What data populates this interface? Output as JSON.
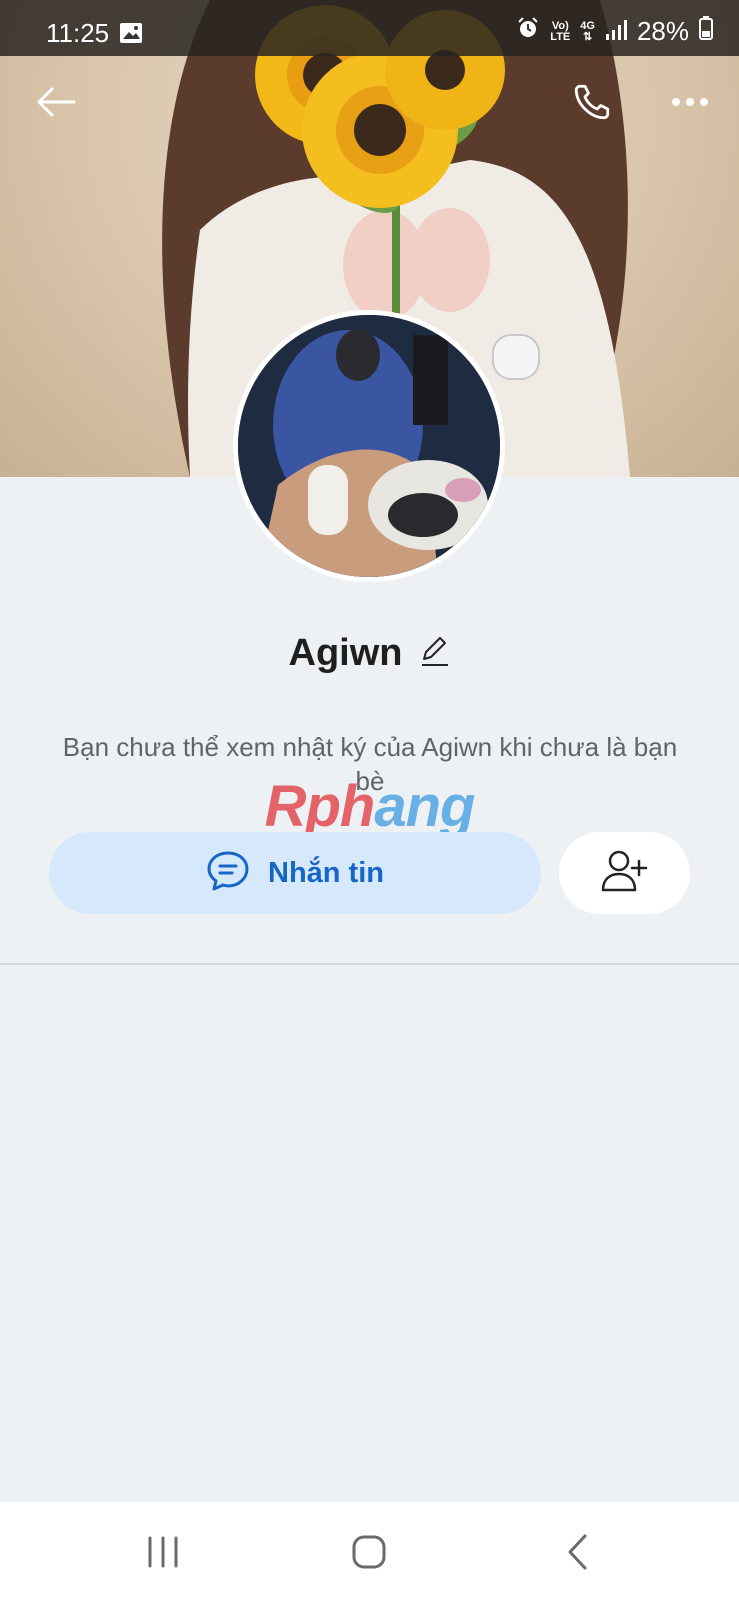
{
  "status_bar": {
    "time": "11:25",
    "network_top": "Vo)",
    "network_bottom": "LTE",
    "data_type": "4G",
    "battery": "28%",
    "icons": [
      "gallery-icon",
      "alarm-icon",
      "signal-icon",
      "battery-icon"
    ]
  },
  "header": {
    "icons": [
      "back-arrow-icon",
      "phone-icon",
      "more-icon"
    ]
  },
  "profile": {
    "name": "Agiwn",
    "notice": "Bạn chưa thể xem nhật ký của Agiwn khi chưa là bạn bè"
  },
  "watermark": {
    "part1": "Rph",
    "part2": "ang"
  },
  "actions": {
    "message_label": "Nhắn tin",
    "message_icon": "chat-icon",
    "add_friend_icon": "add-friend-icon"
  },
  "nav": {
    "icons": [
      "recent-apps-icon",
      "home-icon",
      "back-icon"
    ]
  },
  "colors": {
    "background": "#eef1f3",
    "accent": "#1766c7",
    "message_button": "#d6e8fb"
  }
}
